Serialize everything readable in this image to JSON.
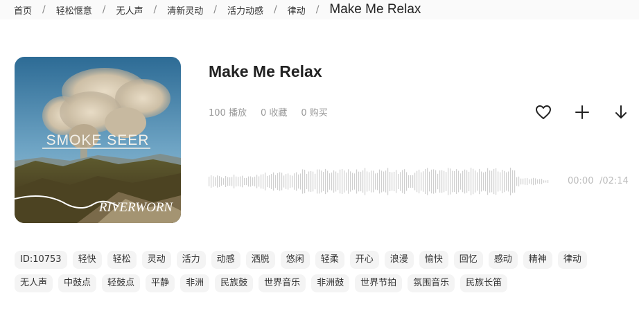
{
  "breadcrumb": {
    "items": [
      "首页",
      "轻松惬意",
      "无人声",
      "清新灵动",
      "活力动感",
      "律动"
    ],
    "current": "Make Me Relax"
  },
  "cover": {
    "artist_text": "SMOKE SEER",
    "logo_text": "RIVERWORN"
  },
  "track": {
    "title": "Make Me Relax",
    "plays": "100 播放",
    "favorites": "0 收藏",
    "purchases": "0 购买"
  },
  "actions": {
    "icons": [
      "heart-icon",
      "plus-icon",
      "download-icon"
    ]
  },
  "player": {
    "current_time": "00:00",
    "total_time": "/02:14",
    "progress": 0
  },
  "tags": [
    "ID:10753",
    "轻快",
    "轻松",
    "灵动",
    "活力",
    "动感",
    "洒脱",
    "悠闲",
    "轻柔",
    "开心",
    "浪漫",
    "愉快",
    "回忆",
    "感动",
    "精神",
    "律动",
    "无人声",
    "中鼓点",
    "轻鼓点",
    "平静",
    "非洲",
    "民族鼓",
    "世界音乐",
    "非洲鼓",
    "世界节拍",
    "氛围音乐",
    "民族长笛"
  ],
  "colors": {
    "waveform": "#cfcfcf",
    "muted_text": "#999999",
    "tag_bg": "#f4f4f4"
  }
}
